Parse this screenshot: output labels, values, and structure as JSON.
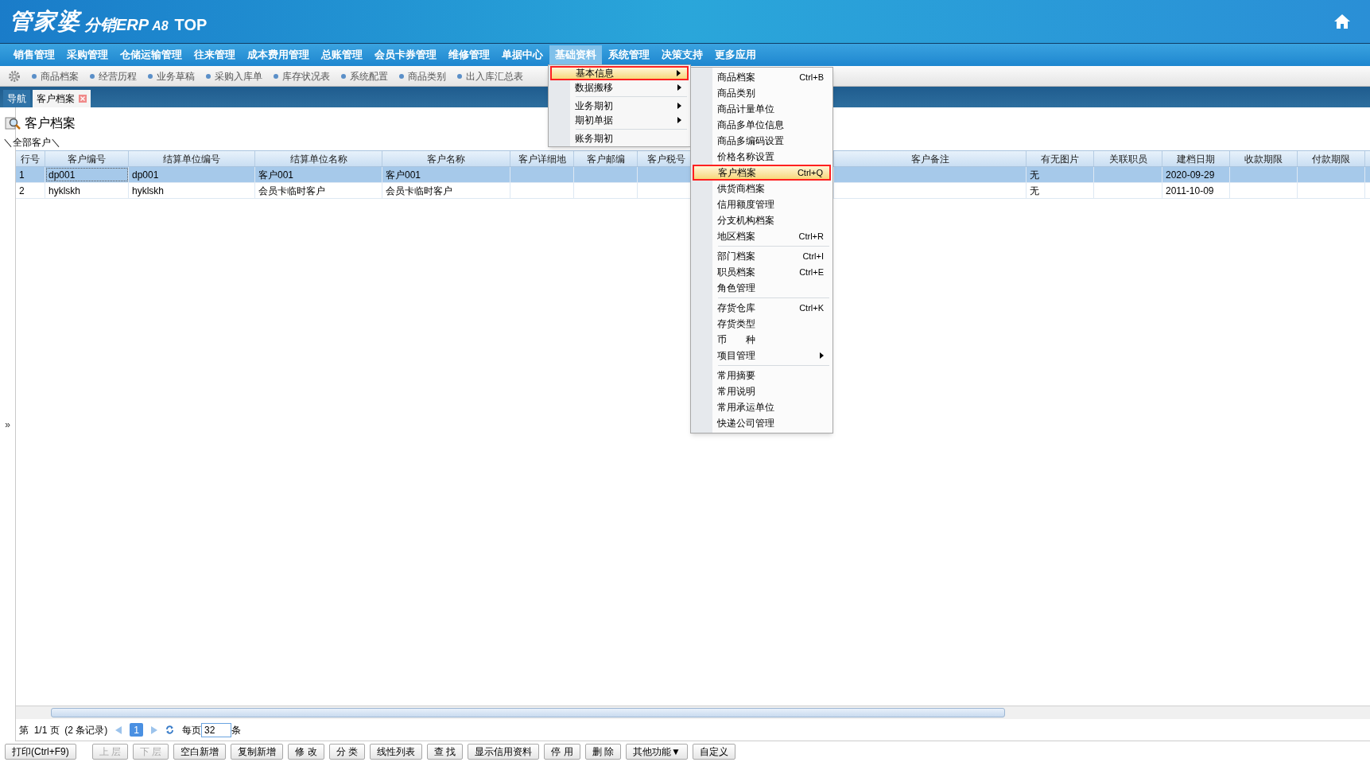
{
  "header": {
    "logo_main": "管家婆",
    "logo_sub": "分销ERP",
    "logo_version": "A8",
    "logo_edition": "TOP"
  },
  "menu_bar": [
    {
      "label": "销售管理",
      "selected": false
    },
    {
      "label": "采购管理",
      "selected": false
    },
    {
      "label": "仓储运输管理",
      "selected": false
    },
    {
      "label": "往来管理",
      "selected": false
    },
    {
      "label": "成本费用管理",
      "selected": false
    },
    {
      "label": "总账管理",
      "selected": false
    },
    {
      "label": "会员卡券管理",
      "selected": false
    },
    {
      "label": "维修管理",
      "selected": false
    },
    {
      "label": "单据中心",
      "selected": false
    },
    {
      "label": "基础资料",
      "selected": true
    },
    {
      "label": "系统管理",
      "selected": false
    },
    {
      "label": "决策支持",
      "selected": false
    },
    {
      "label": "更多应用",
      "selected": false
    }
  ],
  "quick_links": [
    "商品档案",
    "经营历程",
    "业务草稿",
    "采购入库单",
    "库存状况表",
    "系统配置",
    "商品类别",
    "出入库汇总表"
  ],
  "tabs": [
    {
      "label": "导航",
      "selected": false,
      "closable": false
    },
    {
      "label": "客户档案",
      "selected": true,
      "closable": true
    }
  ],
  "page_title": "客户档案",
  "breadcrumb": "＼全部客户＼",
  "expand_toggle": "»",
  "table": {
    "columns": [
      "行号",
      "客户编号",
      "结算单位编号",
      "结算单位名称",
      "客户名称",
      "客户详细地",
      "客户邮编",
      "客户税号",
      "客户备注",
      "有无图片",
      "关联职员",
      "建档日期",
      "收款期限",
      "付款期限"
    ],
    "rows": [
      {
        "selected": true,
        "cells": [
          "1",
          "dp001",
          "dp001",
          "客户001",
          "客户001",
          "",
          "",
          "",
          "",
          "无",
          "",
          "2020-09-29",
          "",
          ""
        ]
      },
      {
        "selected": false,
        "cells": [
          "2",
          "hyklskh",
          "hyklskh",
          "会员卡临时客户",
          "会员卡临时客户",
          "",
          "",
          "",
          "",
          "无",
          "",
          "2011-10-09",
          "",
          ""
        ]
      }
    ]
  },
  "pagination": {
    "summary": "第  1/1 页  (2 条记录)",
    "pages": [
      {
        "label": "1",
        "selected": true
      }
    ],
    "per_page_label": "每页",
    "per_page": "32",
    "unit": "条"
  },
  "toolbar": [
    "打印(Ctrl+F9)",
    "上 层",
    "下 层",
    "空白新增",
    "复制新增",
    "修 改",
    "分 类",
    "线性列表",
    "查 找",
    "显示信用资料",
    "停 用",
    "删 除",
    "其他功能▼",
    "自定义"
  ],
  "menu": [
    {
      "label": "基本信息",
      "submenu": true,
      "selected": true,
      "separator_before": false,
      "annotated": true
    },
    {
      "label": "数据搬移",
      "submenu": true,
      "selected": false,
      "separator_before": false,
      "annotated": false
    },
    {
      "label": "业务期初",
      "submenu": true,
      "selected": false,
      "separator_before": true,
      "annotated": false
    },
    {
      "label": "期初单据",
      "submenu": true,
      "selected": false,
      "separator_before": false,
      "annotated": false
    },
    {
      "label": "账务期初",
      "submenu": false,
      "selected": false,
      "separator_before": true,
      "annotated": false
    }
  ],
  "submenu": [
    {
      "label": "商品档案",
      "shortcut": "Ctrl+B",
      "submenu": false,
      "selected": false,
      "separator_before": false,
      "annotated": false
    },
    {
      "label": "商品类别",
      "submenu": false,
      "selected": false,
      "separator_before": false,
      "annotated": false
    },
    {
      "label": "商品计量单位",
      "submenu": false,
      "selected": false,
      "separator_before": false,
      "annotated": false
    },
    {
      "label": "商品多单位信息",
      "submenu": false,
      "selected": false,
      "separator_before": false,
      "annotated": false
    },
    {
      "label": "商品多编码设置",
      "submenu": false,
      "selected": false,
      "separator_before": false,
      "annotated": false
    },
    {
      "label": "价格名称设置",
      "submenu": false,
      "selected": false,
      "separator_before": false,
      "annotated": false
    },
    {
      "label": "客户档案",
      "shortcut": "Ctrl+Q",
      "submenu": false,
      "selected": true,
      "separator_before": false,
      "annotated": true
    },
    {
      "label": "供货商档案",
      "submenu": false,
      "selected": false,
      "separator_before": false,
      "annotated": false
    },
    {
      "label": "信用额度管理",
      "submenu": false,
      "selected": false,
      "separator_before": false,
      "annotated": false
    },
    {
      "label": "分支机构档案",
      "submenu": false,
      "selected": false,
      "separator_before": false,
      "annotated": false
    },
    {
      "label": "地区档案",
      "shortcut": "Ctrl+R",
      "submenu": false,
      "selected": false,
      "separator_before": false,
      "annotated": false
    },
    {
      "label": "部门档案",
      "shortcut": "Ctrl+I",
      "submenu": false,
      "selected": false,
      "separator_before": true,
      "annotated": false
    },
    {
      "label": "职员档案",
      "shortcut": "Ctrl+E",
      "submenu": false,
      "selected": false,
      "separator_before": false,
      "annotated": false
    },
    {
      "label": "角色管理",
      "submenu": false,
      "selected": false,
      "separator_before": false,
      "annotated": false
    },
    {
      "label": "存货仓库",
      "shortcut": "Ctrl+K",
      "submenu": false,
      "selected": false,
      "separator_before": true,
      "annotated": false
    },
    {
      "label": "存货类型",
      "submenu": false,
      "selected": false,
      "separator_before": false,
      "annotated": false
    },
    {
      "label": "币　　种",
      "submenu": false,
      "selected": false,
      "separator_before": false,
      "annotated": false
    },
    {
      "label": "项目管理",
      "submenu": true,
      "selected": false,
      "separator_before": false,
      "annotated": false
    },
    {
      "label": "常用摘要",
      "submenu": false,
      "selected": false,
      "separator_before": true,
      "annotated": false
    },
    {
      "label": "常用说明",
      "submenu": false,
      "selected": false,
      "separator_before": false,
      "annotated": false
    },
    {
      "label": "常用承运单位",
      "submenu": false,
      "selected": false,
      "separator_before": false,
      "annotated": false
    },
    {
      "label": "快递公司管理",
      "submenu": false,
      "selected": false,
      "separator_before": false,
      "annotated": false
    }
  ]
}
